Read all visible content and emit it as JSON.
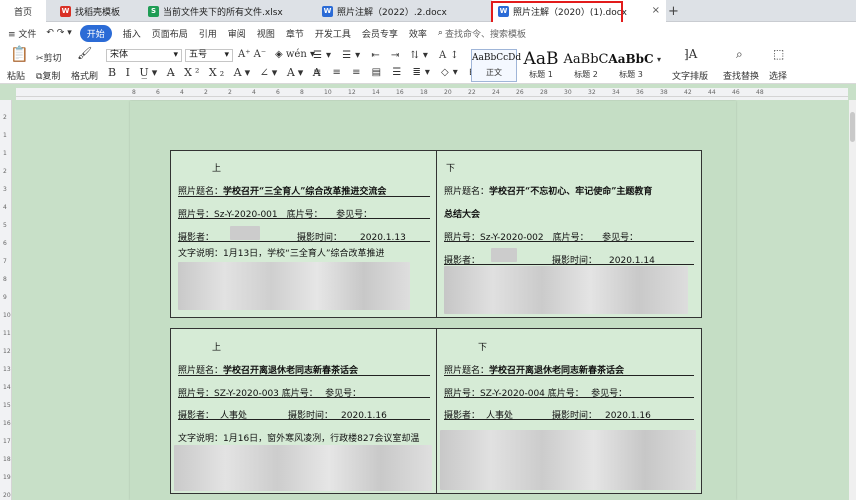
{
  "tabs": {
    "home": "首页",
    "tab2": "找稻壳模板",
    "tab3": "当前文件夹下的所有文件.xlsx",
    "tab4": "照片注解（2022）.2.docx",
    "tab5": "照片注解（2020）(1).docx",
    "plus": "+",
    "close": "×"
  },
  "ribbon_tabs": {
    "file": "≡ 文件",
    "start": "开始",
    "insert": "插入",
    "layout": "页面布局",
    "refs": "引用",
    "review": "审阅",
    "view": "视图",
    "section": "章节",
    "dev": "开发工具",
    "member": "会员专享",
    "efficiency": "效率",
    "search": "查找命令、搜索模板"
  },
  "ribbon": {
    "paste": "粘贴",
    "cut": "剪切",
    "copy": "复制",
    "format_painter": "格式刷",
    "font_name": "宋体",
    "font_size": "五号",
    "text_layout": "文字排版",
    "find_replace": "查找替换",
    "select": "选择",
    "styles": [
      {
        "preview": "AaBbCcDd",
        "label": "正文"
      },
      {
        "preview": "AaB",
        "label": "标题 1"
      },
      {
        "preview": "AaBbC",
        "label": "标题 2"
      },
      {
        "preview": "AaBbC",
        "label": "标题 3"
      }
    ]
  },
  "ruler": {
    "h_marks": [
      "8",
      "6",
      "4",
      "2",
      "2",
      "4",
      "6",
      "8",
      "10",
      "12",
      "14",
      "16",
      "18",
      "20",
      "22",
      "24",
      "26",
      "28",
      "30",
      "32",
      "34",
      "36",
      "38",
      "42",
      "44",
      "46",
      "48"
    ],
    "v_marks": [
      "2",
      "1",
      "1",
      "2",
      "3",
      "4",
      "5",
      "6",
      "7",
      "8",
      "9",
      "10",
      "11",
      "12",
      "13",
      "14",
      "15",
      "16",
      "17",
      "18",
      "19",
      "20"
    ]
  },
  "cells": {
    "c1": {
      "pos": "上",
      "title_label": "照片题名：",
      "title": "学校召开“三全育人”综合改革推进交流会",
      "photo_no": "照片号：Sz-Y-2020-001　底片号：　　参见号：",
      "photographer": "摄影者：",
      "time_label": "摄影时间：",
      "time": "2020.1.13",
      "desc": "文字说明：1月13日，学校“三全育人”综合改革推进"
    },
    "c2": {
      "pos": "下",
      "title_label": "照片题名：",
      "title": "学校召开“不忘初心、牢记使命”主题教育",
      "title2": "总结大会",
      "photo_no": "照片号：Sz-Y-2020-002　底片号：　　参见号：",
      "photographer": "摄影者：",
      "time_label": "摄影时间：",
      "time": "2020.1.14"
    },
    "c3": {
      "pos": "上",
      "title_label": "照片题名：",
      "title": "学校召开离退休老同志新春茶话会",
      "photo_no": "照片号：SZ-Y-2020-003 底片号：　 参见号：",
      "photographer": "摄影者：",
      "photographer_val": "人事处",
      "time_label": "摄影时间：",
      "time": "2020.1.16",
      "desc": "文字说明：1月16日，窗外寒风凌冽，行政楼827会议室却温"
    },
    "c4": {
      "pos": "下",
      "title_label": "照片题名：",
      "title": "学校召开离退休老同志新春茶话会",
      "photo_no": "照片号：SZ-Y-2020-004 底片号：　 参见号：",
      "photographer": "摄影者：",
      "photographer_val": "人事处",
      "time_label": "摄影时间：",
      "time": "2020.1.16"
    }
  },
  "colors": {
    "active_tab_outline": "#e21b1b",
    "accent": "#2b6bd6",
    "page_bg": "#c5dec5"
  }
}
